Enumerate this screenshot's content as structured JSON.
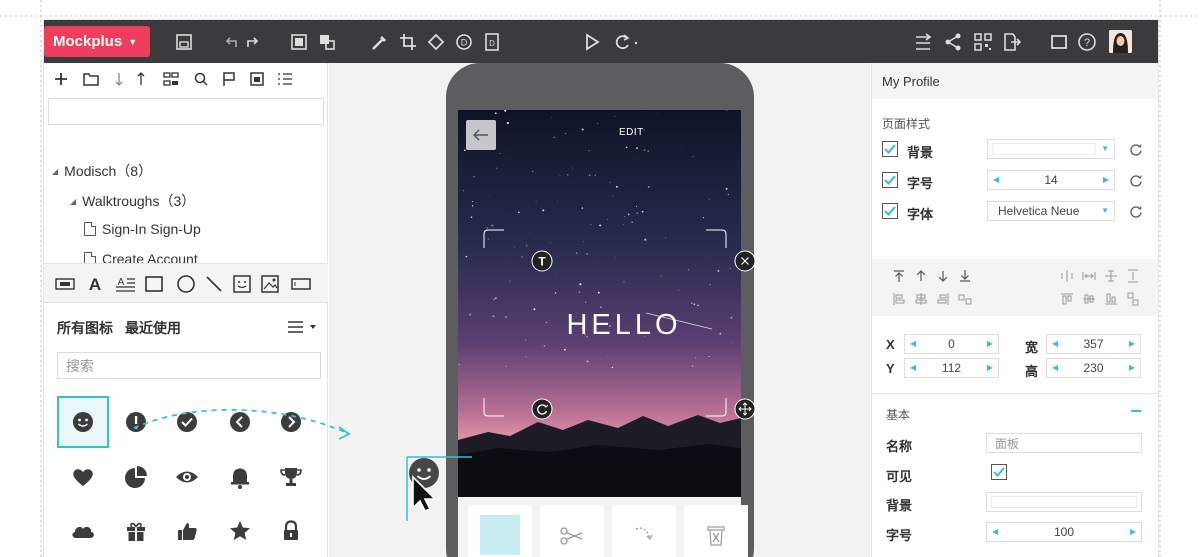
{
  "toolbar": {
    "brand": "Mockplus",
    "icons": [
      "save-icon",
      "undo-icon",
      "redo-icon",
      "group-icon",
      "ungroup-icon",
      "magic-wand-icon",
      "crop-icon",
      "shape-icon",
      "d-badge-icon",
      "page-icon",
      "play-icon",
      "sync-icon",
      "interaction-icon",
      "share-icon",
      "qr-code-icon",
      "export-icon",
      "fullscreen-icon",
      "help-icon",
      "user-avatar"
    ]
  },
  "left": {
    "tree": [
      {
        "label": "Modisch（8）",
        "type": "folder",
        "level": 0
      },
      {
        "label": "Walktroughs（3）",
        "type": "folder",
        "level": 1
      },
      {
        "label": "Sign-In Sign-Up",
        "type": "page",
        "level": 2
      },
      {
        "label": "Create Account",
        "type": "page",
        "level": 2
      }
    ],
    "icons_tab_all": "所有图标",
    "icons_tab_recent": "最近使用",
    "icon_search_placeholder": "搜索",
    "icon_grid": [
      "smile-icon",
      "exclamation-icon",
      "check-icon",
      "chevron-left-icon",
      "chevron-right-icon",
      "heart-icon",
      "pie-chart-icon",
      "eye-icon",
      "bell-icon",
      "trophy-icon",
      "cloud-icon",
      "gift-icon",
      "thumbs-up-icon",
      "star-icon",
      "lock-icon"
    ]
  },
  "canvas": {
    "screen_top_label": "EDIT",
    "hero_text": "HELLO",
    "accent_color": "#35c0d6"
  },
  "right": {
    "page_name": "My Profile",
    "page_style_title": "页面样式",
    "style_rows": [
      {
        "label": "背景",
        "value": ""
      },
      {
        "label": "字号",
        "value": "14"
      },
      {
        "label": "字体",
        "value": "Helvetica Neue"
      }
    ],
    "x_label": "X",
    "x_value": "0",
    "y_label": "Y",
    "y_value": "112",
    "w_label": "宽",
    "w_value": "357",
    "h_label": "高",
    "h_value": "230",
    "basic_title": "基本",
    "name_label": "名称",
    "name_placeholder": "面板",
    "visible_label": "可见",
    "bg_label": "背景",
    "font_size_label": "字号",
    "font_size_value": "100"
  }
}
